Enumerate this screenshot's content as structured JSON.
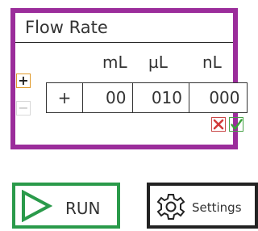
{
  "flow_panel": {
    "title": "Flow Rate",
    "units": [
      "mL",
      "µL",
      "nL"
    ],
    "sign_value": "+",
    "values": [
      "00",
      "010",
      "000"
    ],
    "increment_label": "+",
    "decrement_label": "−"
  },
  "buttons": {
    "run_label": "RUN",
    "settings_label": "Settings"
  },
  "colors": {
    "panel_border": "#9b2d9b",
    "run_border": "#2a9a4a",
    "settings_border": "#222222",
    "cancel": "#d23a3a",
    "confirm": "#3aa33a",
    "increment_border": "#e09a2a"
  },
  "icons": {
    "run": "play-icon",
    "settings": "gear-icon",
    "cancel": "x-icon",
    "confirm": "check-icon"
  }
}
